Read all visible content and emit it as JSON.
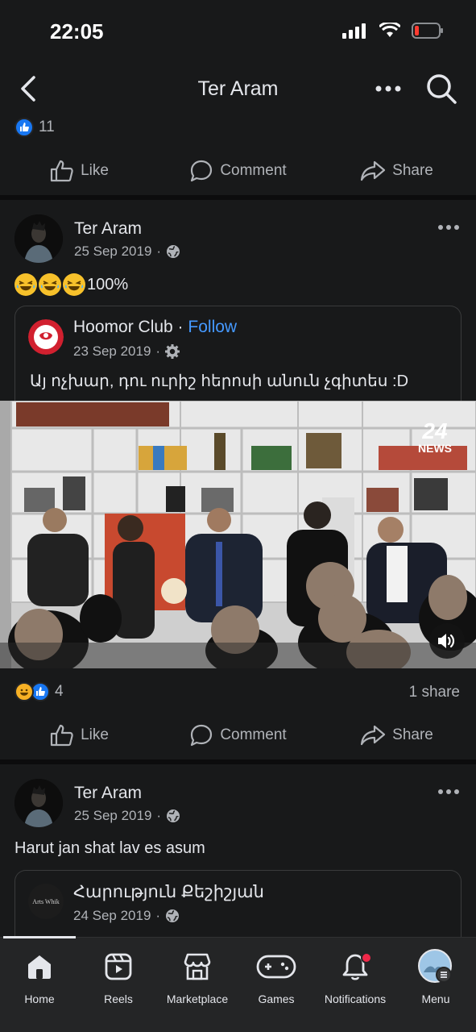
{
  "status_bar": {
    "time": "22:05"
  },
  "header": {
    "title": "Ter Aram"
  },
  "prev_post": {
    "reaction_count": "11",
    "actions": {
      "like": "Like",
      "comment": "Comment",
      "share": "Share"
    }
  },
  "post1": {
    "author": "Ter Aram",
    "date": "25 Sep 2019",
    "text_suffix": "100%",
    "shared": {
      "author": "Hoomor Club",
      "separator": " · ",
      "follow": "Follow",
      "date": "23 Sep 2019",
      "text": "Այ ոչխար, դու ուրիշ հերոսի անուն չգիտես :D"
    },
    "video_logo": {
      "number": "24",
      "label": "NEWS"
    },
    "reaction_count": "4",
    "shares": "1 share",
    "actions": {
      "like": "Like",
      "comment": "Comment",
      "share": "Share"
    }
  },
  "post2": {
    "author": "Ter Aram",
    "date": "25 Sep 2019",
    "text": "Harut jan shat lav es asum",
    "shared": {
      "author": "Հարություն Քեշիշյան",
      "date": "24 Sep 2019",
      "avatar_text": "Arts Whik"
    }
  },
  "bottom_nav": {
    "items": [
      {
        "label": "Home",
        "icon": "home-icon"
      },
      {
        "label": "Reels",
        "icon": "reels-icon"
      },
      {
        "label": "Marketplace",
        "icon": "marketplace-icon"
      },
      {
        "label": "Games",
        "icon": "games-icon"
      },
      {
        "label": "Notifications",
        "icon": "bell-icon"
      },
      {
        "label": "Menu",
        "icon": "profile-avatar-icon"
      }
    ]
  },
  "colors": {
    "background": "#18191a",
    "accent": "#4599ff",
    "like_blue": "#1877f2",
    "notification_red": "#f02849"
  }
}
